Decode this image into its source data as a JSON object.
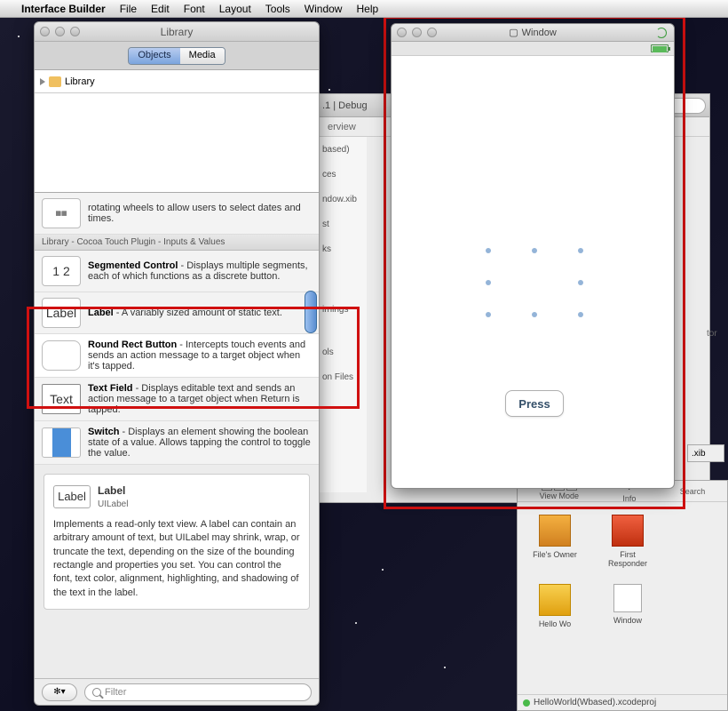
{
  "menubar": {
    "app": "Interface Builder",
    "items": [
      "File",
      "Edit",
      "Font",
      "Layout",
      "Tools",
      "Window",
      "Help"
    ]
  },
  "library": {
    "title": "Library",
    "tabs": {
      "objects": "Objects",
      "media": "Media"
    },
    "tree_root": "Library",
    "datepicker_desc_fragment": "rotating wheels to allow users to select dates and times.",
    "section_header": "Library - Cocoa Touch Plugin - Inputs & Values",
    "items": {
      "segmented": {
        "title": "Segmented Control",
        "desc": " - Displays multiple segments, each of which functions as a discrete button.",
        "thumb": "1 2"
      },
      "label": {
        "title": "Label",
        "desc": " - A variably sized amount of static text.",
        "thumb": "Label"
      },
      "button": {
        "title": "Round Rect Button",
        "desc": " - Intercepts touch events and sends an action message to a target object when it's tapped.",
        "thumb": ""
      },
      "textfield": {
        "title": "Text Field",
        "desc": " - Displays editable text and sends an action message to a target object when Return is tapped.",
        "thumb": "Text"
      },
      "switch": {
        "title": "Switch",
        "desc": " - Displays an element showing the boolean state of a value. Allows tapping the control to toggle the value.",
        "thumb": ""
      }
    },
    "detail": {
      "thumb": "Label",
      "title": "Label",
      "cls": "UILabel",
      "body": "Implements a read-only text view. A label can contain an arbitrary amount of text, but UILabel may shrink, wrap, or truncate the text, depending on the size of the bounding rectangle and properties you set. You can control the font, text color, alignment, highlighting, and shadowing of the text in the label."
    },
    "filter_placeholder": "Filter"
  },
  "sim": {
    "title": "Window",
    "button": "Press"
  },
  "bgwin": {
    "config": ".1 | Debug",
    "overview": "erview",
    "side": [
      "based)",
      "ces",
      "ndow.xib",
      "st",
      "ks",
      "irnings",
      "ols",
      "on Files"
    ]
  },
  "docwin": {
    "toolbar": {
      "view_mode": "View Mode",
      "info": "Info",
      "search": "Search"
    },
    "icons": {
      "owner": "File's Owner",
      "responder": "First Responder",
      "hello": "Hello Wo",
      "window": "Window"
    },
    "statusline": "HelloWorld(Wbased).xcodeproj"
  },
  "extras": {
    "xib": ".xib",
    "tor": "tor",
    "q": "Q-"
  }
}
